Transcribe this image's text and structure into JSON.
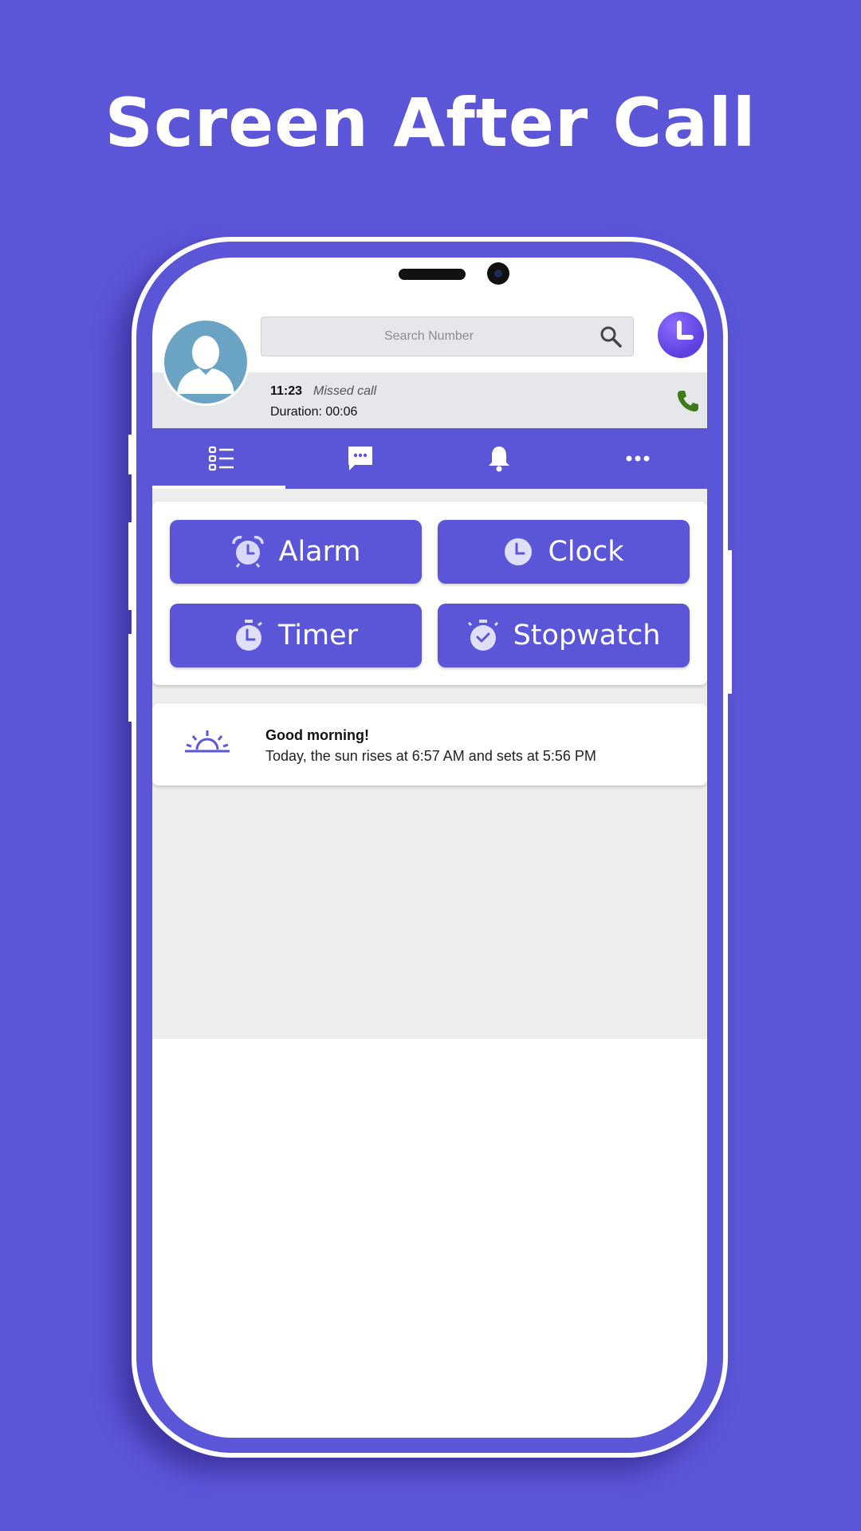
{
  "headline": "Screen After Call",
  "search": {
    "placeholder": "Search Number"
  },
  "call": {
    "time": "11:23",
    "status": "Missed call",
    "duration": "Duration: 00:06"
  },
  "tabs": [
    {
      "icon": "list-icon",
      "selected": true
    },
    {
      "icon": "message-icon",
      "selected": false
    },
    {
      "icon": "bell-icon",
      "selected": false
    },
    {
      "icon": "more-icon",
      "selected": false
    }
  ],
  "actions": {
    "alarm": "Alarm",
    "clock": "Clock",
    "timer": "Timer",
    "stopwatch": "Stopwatch"
  },
  "greeting": {
    "title": "Good morning!",
    "body": "Today, the sun rises at 6:57 AM and sets at 5:56 PM"
  },
  "colors": {
    "brand": "#5B55D8",
    "call_green": "#3f7a1a",
    "avatar_bg": "#6aa3c4"
  }
}
